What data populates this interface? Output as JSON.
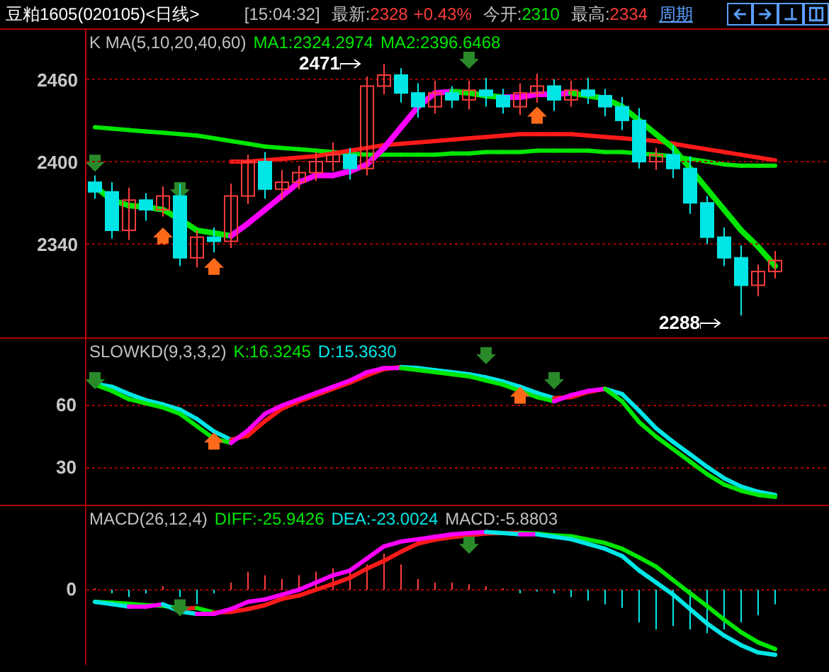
{
  "header": {
    "title": "豆粕1605(020105)<日线>",
    "time": "[15:04:32]",
    "quotes": [
      {
        "label": "最新:",
        "value": "2328",
        "change": "+0.43%",
        "color": "#ff3c3c"
      },
      {
        "label": "今开:",
        "value": "2310",
        "color": "#00e600"
      },
      {
        "label": "最高:",
        "value": "2334",
        "color": "#ff3c3c"
      }
    ],
    "period_link": "周期"
  },
  "panels": [
    {
      "kind": "price",
      "legend": [
        {
          "text": "K  MA(5,10,20,40,60)",
          "color": "#c0c0c0"
        },
        {
          "text": "MA1:2324.2974",
          "color": "#00e600"
        },
        {
          "text": "MA2:2396.6468",
          "color": "#00e600"
        }
      ],
      "y_labels": [
        "2460",
        "2400",
        "2340"
      ],
      "annotations": [
        "2471",
        "2288"
      ],
      "chart_data": {
        "type": "candlestick",
        "ylim": [
          2271,
          2496
        ],
        "yticks": [
          2460,
          2400,
          2340
        ],
        "grid": true,
        "ohlc": [
          [
            2385,
            2390,
            2373,
            2378
          ],
          [
            2378,
            2385,
            2344,
            2350
          ],
          [
            2350,
            2381,
            2343,
            2372
          ],
          [
            2372,
            2377,
            2357,
            2365
          ],
          [
            2365,
            2382,
            2360,
            2375
          ],
          [
            2375,
            2384,
            2324,
            2330
          ],
          [
            2330,
            2350,
            2323,
            2345
          ],
          [
            2345,
            2352,
            2334,
            2342
          ],
          [
            2342,
            2384,
            2337,
            2375
          ],
          [
            2375,
            2405,
            2369,
            2400
          ],
          [
            2400,
            2407,
            2373,
            2380
          ],
          [
            2380,
            2394,
            2372,
            2385
          ],
          [
            2385,
            2397,
            2380,
            2392
          ],
          [
            2392,
            2407,
            2386,
            2400
          ],
          [
            2400,
            2414,
            2393,
            2405
          ],
          [
            2405,
            2410,
            2387,
            2395
          ],
          [
            2395,
            2462,
            2390,
            2455
          ],
          [
            2455,
            2471,
            2449,
            2463
          ],
          [
            2463,
            2468,
            2443,
            2450
          ],
          [
            2450,
            2457,
            2432,
            2440
          ],
          [
            2440,
            2459,
            2435,
            2450
          ],
          [
            2450,
            2455,
            2439,
            2445
          ],
          [
            2445,
            2459,
            2438,
            2452
          ],
          [
            2452,
            2461,
            2440,
            2448
          ],
          [
            2448,
            2453,
            2435,
            2440
          ],
          [
            2440,
            2457,
            2434,
            2450
          ],
          [
            2450,
            2464,
            2443,
            2455
          ],
          [
            2455,
            2460,
            2437,
            2445
          ],
          [
            2445,
            2459,
            2440,
            2452
          ],
          [
            2452,
            2461,
            2442,
            2448
          ],
          [
            2448,
            2453,
            2433,
            2440
          ],
          [
            2440,
            2447,
            2423,
            2430
          ],
          [
            2430,
            2439,
            2395,
            2400
          ],
          [
            2400,
            2410,
            2394,
            2405
          ],
          [
            2405,
            2412,
            2388,
            2395
          ],
          [
            2395,
            2404,
            2362,
            2370
          ],
          [
            2370,
            2375,
            2340,
            2345
          ],
          [
            2345,
            2352,
            2324,
            2330
          ],
          [
            2330,
            2339,
            2288,
            2310
          ],
          [
            2310,
            2325,
            2302,
            2320
          ],
          [
            2320,
            2335,
            2315,
            2328
          ]
        ]
      }
    },
    {
      "kind": "kd",
      "legend": [
        {
          "text": "SLOWKD(9,3,3,2)",
          "color": "#c0c0c0"
        },
        {
          "text": "K:16.3245",
          "color": "#00e600"
        },
        {
          "text": "D:15.3630",
          "color": "#00e6e6"
        }
      ],
      "y_labels": [
        "60",
        "30"
      ]
    },
    {
      "kind": "macd",
      "legend": [
        {
          "text": "MACD(26,12,4)",
          "color": "#c0c0c0"
        },
        {
          "text": "DIFF:-25.9426",
          "color": "#00e600"
        },
        {
          "text": "DEA:-23.0024",
          "color": "#00e6e6"
        },
        {
          "text": "MACD:-5.8803",
          "color": "#c0c0c0"
        }
      ],
      "y_labels": [
        "0"
      ]
    }
  ]
}
